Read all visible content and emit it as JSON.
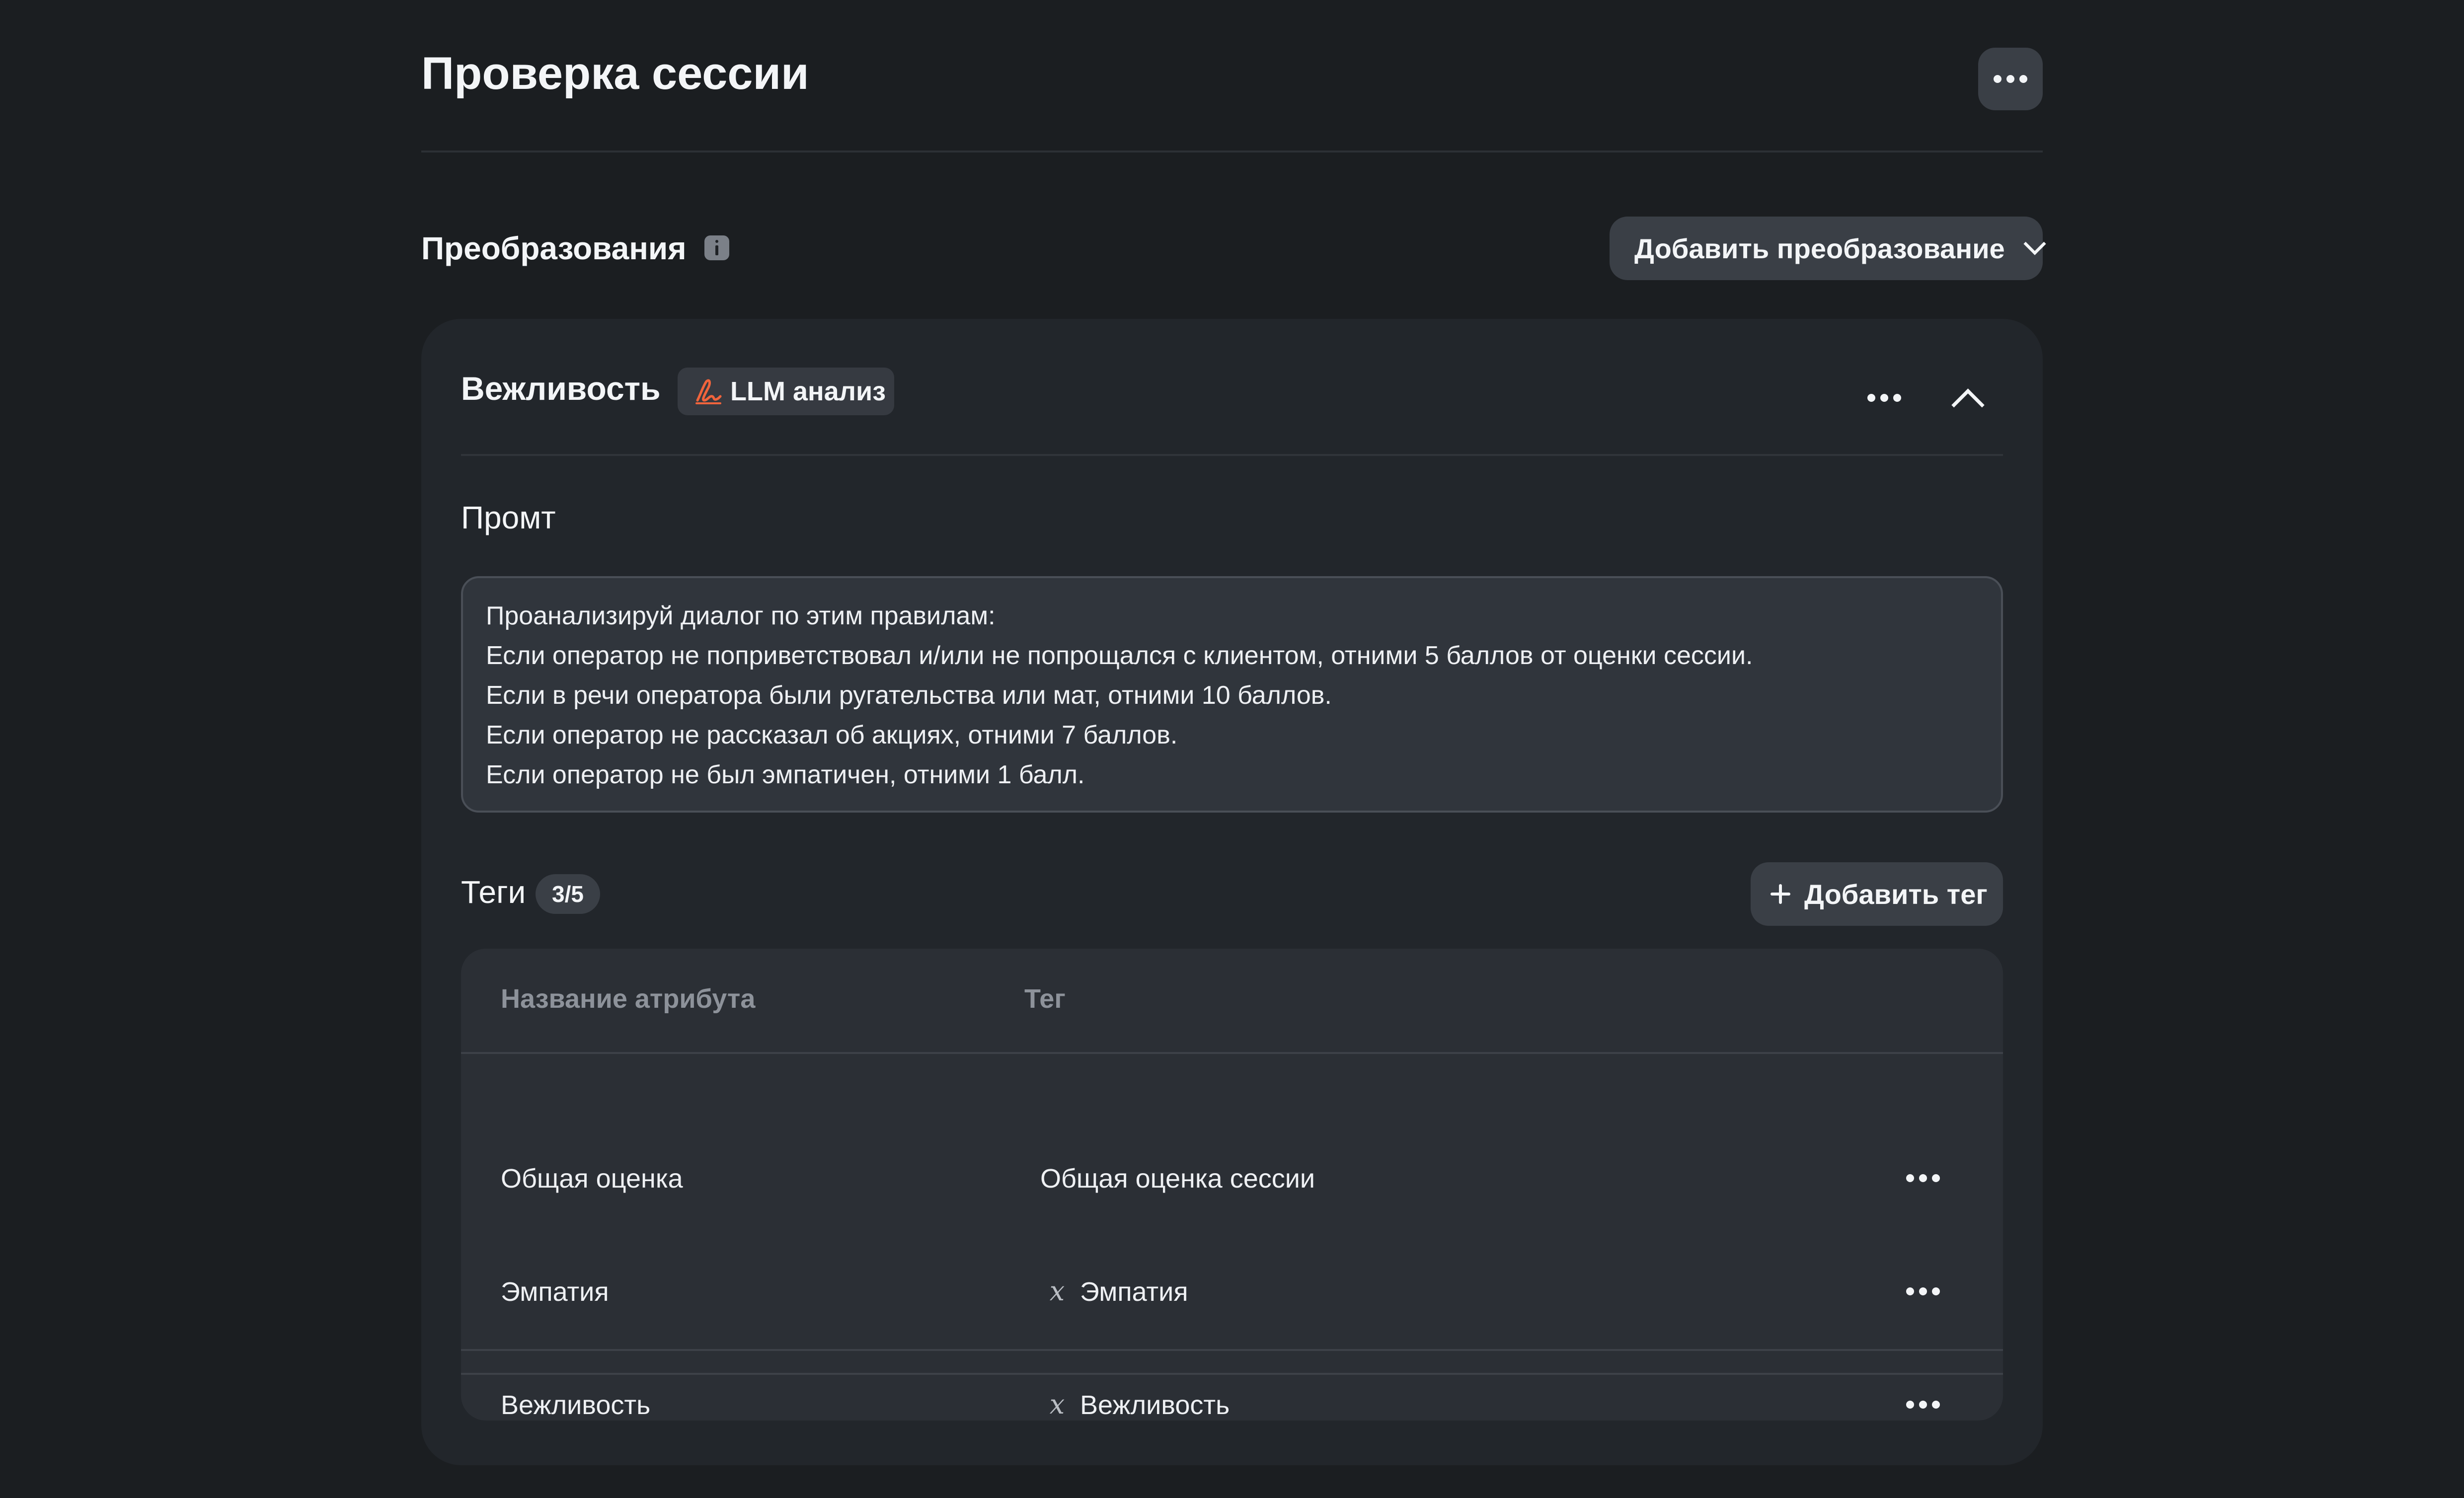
{
  "header": {
    "title": "Проверка сессии",
    "more_icon": "more-horizontal-icon"
  },
  "section": {
    "title": "Преобразования",
    "info_icon": "info-icon",
    "add_button_label": "Добавить преобразование",
    "add_button_icon": "chevron-down-icon"
  },
  "card": {
    "title": "Вежливость",
    "badge": {
      "icon": "signature-icon",
      "icon_color": "#f0643c",
      "label": "LLM анализ"
    },
    "collapse_icon": "chevron-up-icon",
    "prompt": {
      "label": "Промт",
      "lines": [
        "Проанализируй диалог по этим правилам:",
        "Если оператор не поприветствовал и/или не попрощался с клиентом, отними 5 баллов от оценки сессии.",
        "Если в речи оператора были ругательства или мат, отними 10 баллов.",
        "Если оператор не рассказал об акциях, отними 7 баллов.",
        "Если оператор не был эмпатичен, отними 1 балл."
      ]
    },
    "tags": {
      "label": "Теги",
      "count": "3/5",
      "add_button_label": "Добавить тег",
      "columns": [
        "Название атрибута",
        "Тег"
      ],
      "rows": [
        {
          "attribute": "Общая оценка",
          "tag": "Общая оценка сессии",
          "tag_icon": ""
        },
        {
          "attribute": "Эмпатия",
          "tag": "Эмпатия",
          "tag_icon": "variable-x-icon"
        },
        {
          "attribute": "Вежливость",
          "tag": "Вежливость",
          "tag_icon": "variable-x-icon"
        }
      ]
    }
  },
  "colors": {
    "background": "#1b1e21",
    "card": "#22262b",
    "button": "#3a3f46",
    "accent": "#f0643c"
  }
}
